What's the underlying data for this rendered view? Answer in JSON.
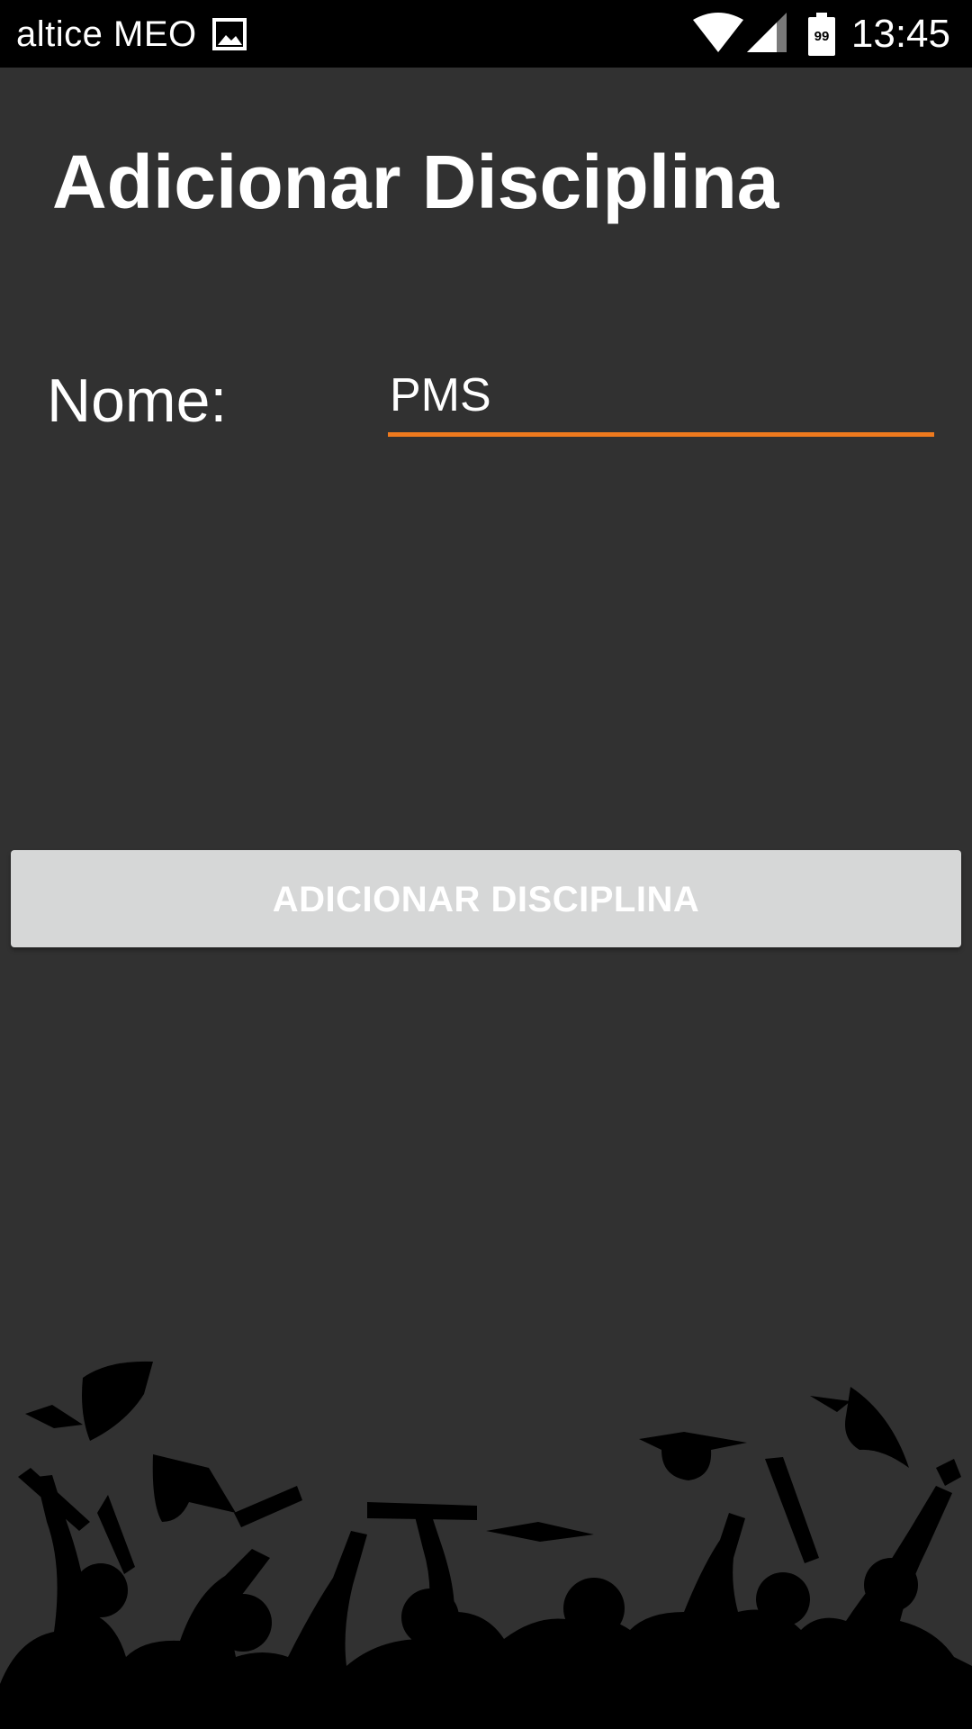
{
  "status_bar": {
    "carrier": "altice MEO",
    "time": "13:45",
    "battery_level": "99",
    "icons": [
      "gallery-icon",
      "wifi-icon",
      "signal-icon",
      "battery-icon"
    ]
  },
  "page": {
    "title": "Adicionar Disciplina"
  },
  "form": {
    "name_label": "Nome:",
    "name_value": "PMS",
    "submit_label": "ADICIONAR DISCIPLINA"
  },
  "colors": {
    "background": "#313131",
    "accent": "#ee7a1e",
    "button_bg": "#d6d7d7",
    "status_bar": "#000000"
  },
  "decorations": {
    "footer_image": "graduation-silhouette"
  }
}
